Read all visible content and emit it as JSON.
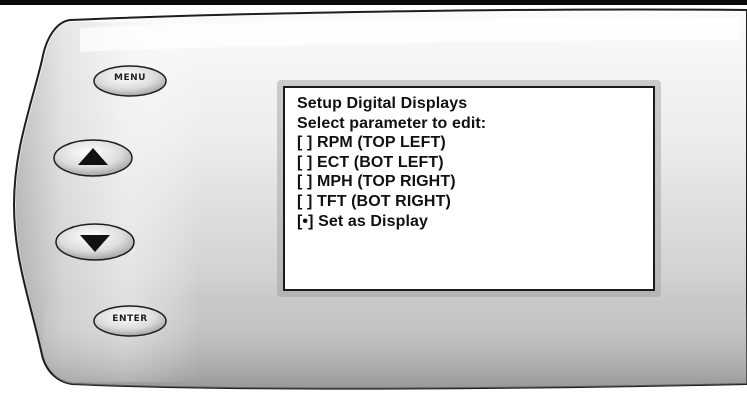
{
  "device": {
    "buttons": {
      "menu_label": "MENU",
      "up_icon": "triangle-up-icon",
      "down_icon": "triangle-down-icon",
      "enter_label": "ENTER"
    }
  },
  "screen": {
    "title": "Setup Digital Displays",
    "subtitle": "Select parameter to edit:",
    "options": [
      {
        "marker": "[ ]",
        "label": "RPM (TOP LEFT)"
      },
      {
        "marker": "[ ]",
        "label": "ECT (BOT LEFT)"
      },
      {
        "marker": "[ ]",
        "label": "MPH (TOP RIGHT)"
      },
      {
        "marker": "[ ]",
        "label": "TFT (BOT RIGHT)"
      },
      {
        "marker": "[•]",
        "label": "Set as Display"
      }
    ]
  },
  "colors": {
    "body_light": "#f2f2f2",
    "body_mid": "#cfcfcf",
    "body_dark": "#8e8e8e",
    "outline": "#1e1e1e",
    "screen_bg": "#ffffff",
    "text": "#111111"
  }
}
